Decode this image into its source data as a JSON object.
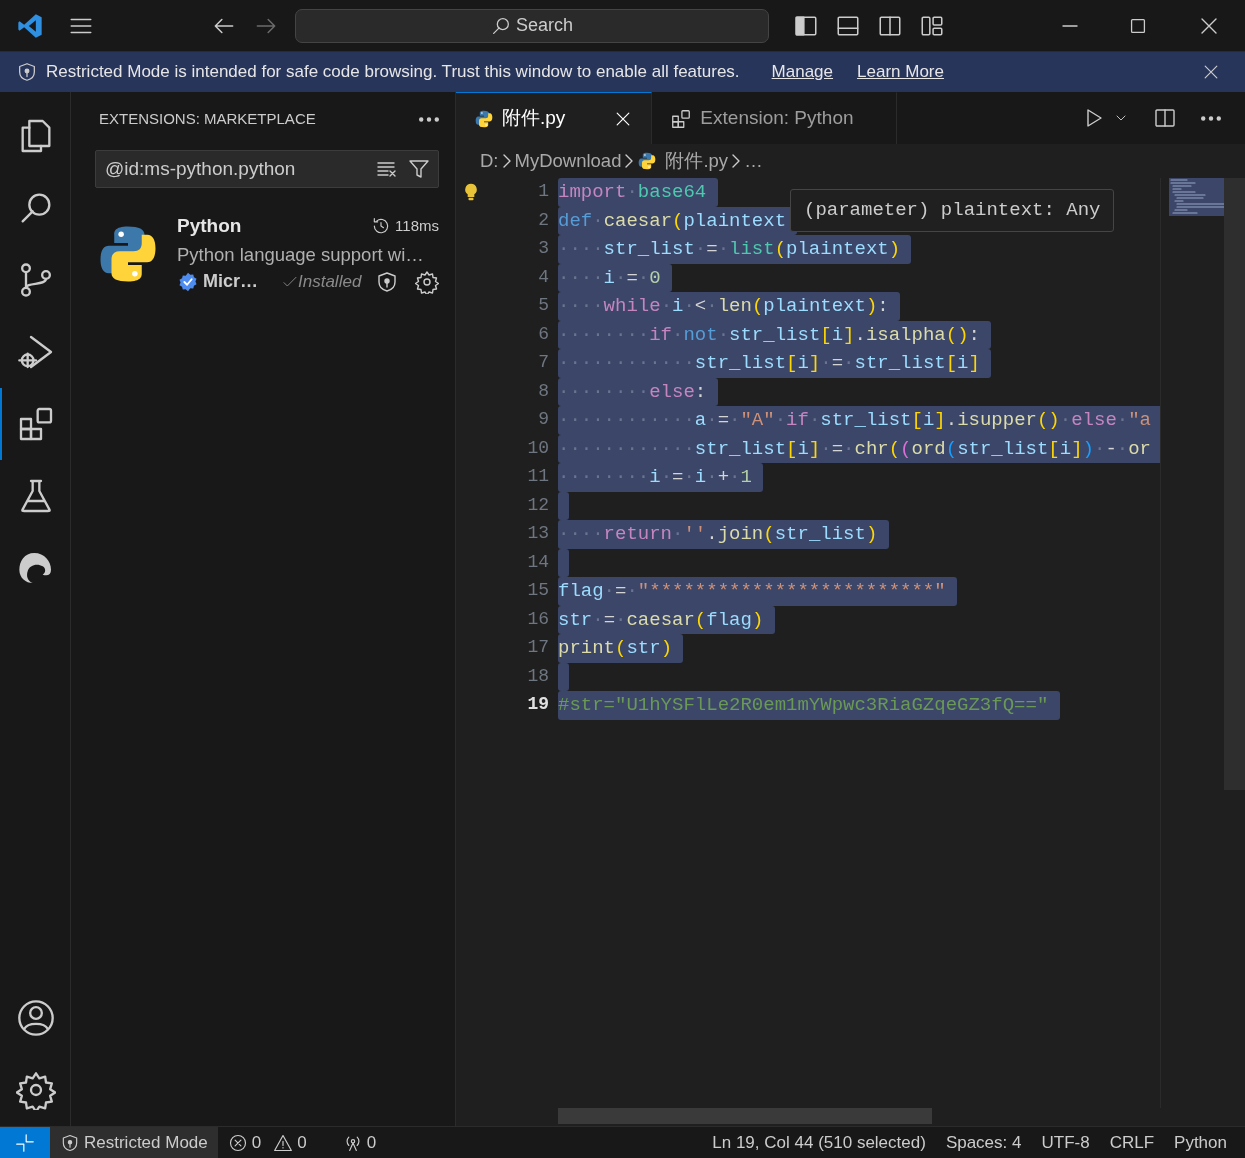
{
  "title_bar": {
    "nav": [
      {
        "kind": "back",
        "disabled": false
      },
      {
        "kind": "forward",
        "disabled": true
      }
    ],
    "command_center": {
      "label": "Search"
    }
  },
  "banner": {
    "message": "Restricted Mode is intended for safe code browsing. Trust this window to enable all features.",
    "links": [
      "Manage",
      "Learn More"
    ]
  },
  "activity_bar": {
    "top": [
      {
        "selected": false
      },
      {
        "selected": false
      },
      {
        "selected": false
      },
      {
        "selected": false
      },
      {
        "selected": true
      },
      {
        "selected": false
      },
      {
        "selected": false
      }
    ],
    "bottom": [
      {
        "selected": false
      },
      {
        "selected": false
      }
    ]
  },
  "sidebar": {
    "title": "EXTENSIONS: MARKETPLACE",
    "search": {
      "value": "@id:ms-python.python"
    },
    "extension": {
      "name": "Python",
      "time": "118ms",
      "description": "Python language support wi…",
      "publisher": "Micr…",
      "status": "Installed"
    }
  },
  "tabs": [
    {
      "label": "附件.py",
      "kind": "python",
      "selected": true
    },
    {
      "label": "Extension: Python",
      "kind": "extension",
      "selected": false
    }
  ],
  "breadcrumb": [
    {
      "text": "D:"
    },
    {
      "text": "MyDownload"
    },
    {
      "text": "附件.py",
      "kind": "python"
    },
    {
      "text": "…"
    }
  ],
  "editor": {
    "tooltip": "(parameter) plaintext: Any",
    "lines": [
      {
        "number": "1",
        "selected": true,
        "current": false,
        "tokens": [
          {
            "kind": "kw",
            "t": "import"
          },
          {
            "kind": "ws",
            "t": "·"
          },
          {
            "kind": "mod",
            "t": "base64"
          }
        ]
      },
      {
        "number": "2",
        "selected": true,
        "current": false,
        "tokens": [
          {
            "kind": "st",
            "t": "def"
          },
          {
            "kind": "ws",
            "t": "·"
          },
          {
            "kind": "fn",
            "t": "caesar"
          },
          {
            "kind": "b1",
            "t": "("
          },
          {
            "kind": "var",
            "t": "plaintext"
          }
        ]
      },
      {
        "number": "3",
        "selected": true,
        "current": false,
        "tokens": [
          {
            "kind": "ws",
            "t": "····"
          },
          {
            "kind": "var",
            "t": "str_list"
          },
          {
            "kind": "ws",
            "t": "·"
          },
          {
            "kind": "op",
            "t": "="
          },
          {
            "kind": "ws",
            "t": "·"
          },
          {
            "kind": "mod",
            "t": "list"
          },
          {
            "kind": "b1",
            "t": "("
          },
          {
            "kind": "var",
            "t": "plaintext"
          },
          {
            "kind": "b1",
            "t": ")"
          }
        ]
      },
      {
        "number": "4",
        "selected": true,
        "current": false,
        "tokens": [
          {
            "kind": "ws",
            "t": "····"
          },
          {
            "kind": "var",
            "t": "i"
          },
          {
            "kind": "ws",
            "t": "·"
          },
          {
            "kind": "op",
            "t": "="
          },
          {
            "kind": "ws",
            "t": "·"
          },
          {
            "kind": "num",
            "t": "0"
          }
        ]
      },
      {
        "number": "5",
        "selected": true,
        "current": false,
        "tokens": [
          {
            "kind": "ws",
            "t": "····"
          },
          {
            "kind": "kw",
            "t": "while"
          },
          {
            "kind": "ws",
            "t": "·"
          },
          {
            "kind": "var",
            "t": "i"
          },
          {
            "kind": "ws",
            "t": "·"
          },
          {
            "kind": "op",
            "t": "<"
          },
          {
            "kind": "ws",
            "t": "·"
          },
          {
            "kind": "fn",
            "t": "len"
          },
          {
            "kind": "b1",
            "t": "("
          },
          {
            "kind": "var",
            "t": "plaintext"
          },
          {
            "kind": "b1",
            "t": ")"
          },
          {
            "kind": "op",
            "t": ":"
          }
        ]
      },
      {
        "number": "6",
        "selected": true,
        "current": false,
        "tokens": [
          {
            "kind": "ws",
            "t": "········"
          },
          {
            "kind": "kw",
            "t": "if"
          },
          {
            "kind": "ws",
            "t": "·"
          },
          {
            "kind": "st",
            "t": "not"
          },
          {
            "kind": "ws",
            "t": "·"
          },
          {
            "kind": "var",
            "t": "str_list"
          },
          {
            "kind": "b1",
            "t": "["
          },
          {
            "kind": "var",
            "t": "i"
          },
          {
            "kind": "b1",
            "t": "]"
          },
          {
            "kind": "op",
            "t": "."
          },
          {
            "kind": "fn",
            "t": "isalpha"
          },
          {
            "kind": "b1",
            "t": "()"
          },
          {
            "kind": "op",
            "t": ":"
          }
        ]
      },
      {
        "number": "7",
        "selected": true,
        "current": false,
        "tokens": [
          {
            "kind": "ws",
            "t": "············"
          },
          {
            "kind": "var",
            "t": "str_list"
          },
          {
            "kind": "b1",
            "t": "["
          },
          {
            "kind": "var",
            "t": "i"
          },
          {
            "kind": "b1",
            "t": "]"
          },
          {
            "kind": "ws",
            "t": "·"
          },
          {
            "kind": "op",
            "t": "="
          },
          {
            "kind": "ws",
            "t": "·"
          },
          {
            "kind": "var",
            "t": "str_list"
          },
          {
            "kind": "b1",
            "t": "["
          },
          {
            "kind": "var",
            "t": "i"
          },
          {
            "kind": "b1",
            "t": "]"
          }
        ]
      },
      {
        "number": "8",
        "selected": true,
        "current": false,
        "tokens": [
          {
            "kind": "ws",
            "t": "········"
          },
          {
            "kind": "kw",
            "t": "else"
          },
          {
            "kind": "op",
            "t": ":"
          }
        ]
      },
      {
        "number": "9",
        "selected": true,
        "current": false,
        "tokens": [
          {
            "kind": "ws",
            "t": "············"
          },
          {
            "kind": "var",
            "t": "a"
          },
          {
            "kind": "ws",
            "t": "·"
          },
          {
            "kind": "op",
            "t": "="
          },
          {
            "kind": "ws",
            "t": "·"
          },
          {
            "kind": "str",
            "t": "\"A\""
          },
          {
            "kind": "ws",
            "t": "·"
          },
          {
            "kind": "kw",
            "t": "if"
          },
          {
            "kind": "ws",
            "t": "·"
          },
          {
            "kind": "var",
            "t": "str_list"
          },
          {
            "kind": "b1",
            "t": "["
          },
          {
            "kind": "var",
            "t": "i"
          },
          {
            "kind": "b1",
            "t": "]"
          },
          {
            "kind": "op",
            "t": "."
          },
          {
            "kind": "fn",
            "t": "isupper"
          },
          {
            "kind": "b1",
            "t": "()"
          },
          {
            "kind": "ws",
            "t": "·"
          },
          {
            "kind": "kw",
            "t": "else"
          },
          {
            "kind": "ws",
            "t": "·"
          },
          {
            "kind": "str",
            "t": "\"a"
          }
        ]
      },
      {
        "number": "10",
        "selected": true,
        "current": false,
        "tokens": [
          {
            "kind": "ws",
            "t": "············"
          },
          {
            "kind": "var",
            "t": "str_list"
          },
          {
            "kind": "b1",
            "t": "["
          },
          {
            "kind": "var",
            "t": "i"
          },
          {
            "kind": "b1",
            "t": "]"
          },
          {
            "kind": "ws",
            "t": "·"
          },
          {
            "kind": "op",
            "t": "="
          },
          {
            "kind": "ws",
            "t": "·"
          },
          {
            "kind": "fn",
            "t": "chr"
          },
          {
            "kind": "b1",
            "t": "("
          },
          {
            "kind": "b2",
            "t": "("
          },
          {
            "kind": "fn",
            "t": "ord"
          },
          {
            "kind": "b3",
            "t": "("
          },
          {
            "kind": "var",
            "t": "str_list"
          },
          {
            "kind": "b1",
            "t": "["
          },
          {
            "kind": "var",
            "t": "i"
          },
          {
            "kind": "b1",
            "t": "]"
          },
          {
            "kind": "b3",
            "t": ")"
          },
          {
            "kind": "ws",
            "t": "·"
          },
          {
            "kind": "op",
            "t": "-"
          },
          {
            "kind": "ws",
            "t": "·"
          },
          {
            "kind": "fn",
            "t": "or"
          }
        ]
      },
      {
        "number": "11",
        "selected": true,
        "current": false,
        "tokens": [
          {
            "kind": "ws",
            "t": "········"
          },
          {
            "kind": "var",
            "t": "i"
          },
          {
            "kind": "ws",
            "t": "·"
          },
          {
            "kind": "op",
            "t": "="
          },
          {
            "kind": "ws",
            "t": "·"
          },
          {
            "kind": "var",
            "t": "i"
          },
          {
            "kind": "ws",
            "t": "·"
          },
          {
            "kind": "op",
            "t": "+"
          },
          {
            "kind": "ws",
            "t": "·"
          },
          {
            "kind": "num",
            "t": "1"
          }
        ]
      },
      {
        "number": "12",
        "selected": true,
        "current": false
      },
      {
        "number": "13",
        "selected": true,
        "current": false,
        "tokens": [
          {
            "kind": "ws",
            "t": "····"
          },
          {
            "kind": "kw",
            "t": "return"
          },
          {
            "kind": "ws",
            "t": "·"
          },
          {
            "kind": "str",
            "t": "''"
          },
          {
            "kind": "op",
            "t": "."
          },
          {
            "kind": "fn",
            "t": "join"
          },
          {
            "kind": "b1",
            "t": "("
          },
          {
            "kind": "var",
            "t": "str_list"
          },
          {
            "kind": "b1",
            "t": ")"
          }
        ]
      },
      {
        "number": "14",
        "selected": true,
        "current": false
      },
      {
        "number": "15",
        "selected": true,
        "current": false,
        "tokens": [
          {
            "kind": "var",
            "t": "flag"
          },
          {
            "kind": "ws",
            "t": "·"
          },
          {
            "kind": "op",
            "t": "="
          },
          {
            "kind": "ws",
            "t": "·"
          },
          {
            "kind": "str",
            "t": "\"*************************\""
          }
        ]
      },
      {
        "number": "16",
        "selected": true,
        "current": false,
        "tokens": [
          {
            "kind": "var",
            "t": "str"
          },
          {
            "kind": "ws",
            "t": "·"
          },
          {
            "kind": "op",
            "t": "="
          },
          {
            "kind": "ws",
            "t": "·"
          },
          {
            "kind": "fn",
            "t": "caesar"
          },
          {
            "kind": "b1",
            "t": "("
          },
          {
            "kind": "var",
            "t": "flag"
          },
          {
            "kind": "b1",
            "t": ")"
          }
        ]
      },
      {
        "number": "17",
        "selected": true,
        "current": false,
        "tokens": [
          {
            "kind": "fn",
            "t": "print"
          },
          {
            "kind": "b1",
            "t": "("
          },
          {
            "kind": "var",
            "t": "str"
          },
          {
            "kind": "b1",
            "t": ")"
          }
        ]
      },
      {
        "number": "18",
        "selected": true,
        "current": false
      },
      {
        "number": "19",
        "selected": true,
        "current": true,
        "tokens": [
          {
            "kind": "com",
            "t": "#str=\"U1hYSFlLe2R0em1mYWpwc3RiaGZqeGZ3fQ==\""
          }
        ]
      }
    ]
  },
  "status_bar": {
    "left": [
      {
        "kind": "remote"
      },
      {
        "kind": "restricted",
        "text": "Restricted Mode"
      },
      {
        "kind": "problems",
        "errors": "0",
        "warnings": "0"
      },
      {
        "kind": "ports",
        "text": "0"
      }
    ],
    "right": [
      {
        "kind": "text",
        "text": "Ln 19, Col 44 (510 selected)"
      },
      {
        "kind": "text",
        "text": "Spaces: 4"
      },
      {
        "kind": "text",
        "text": "UTF-8"
      },
      {
        "kind": "text",
        "text": "CRLF"
      },
      {
        "kind": "text",
        "text": "Python"
      }
    ]
  }
}
